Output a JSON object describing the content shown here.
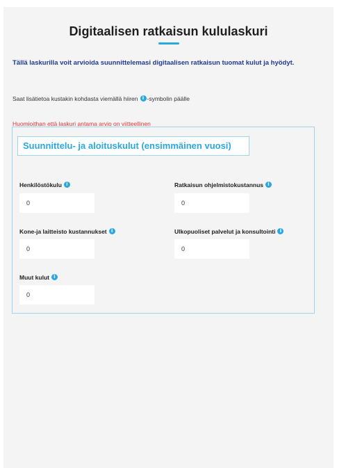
{
  "page": {
    "title": "Digitaalisen ratkaisun kululaskuri",
    "intro": "Tällä laskurilla voit arvioida suunnittelemasi digitaalisen ratkaisun tuomat kulut ja hyödyt.",
    "info_text_before": "Saat lisätietoa kustakin kohdasta viemällä hiiren",
    "info_text_after": "-symbolin päälle",
    "warning": "Huomioithan että laskuri antama arvio on viitteellinen"
  },
  "section": {
    "title": "Suunnittelu- ja aloituskulut (ensimmäinen vuosi)"
  },
  "fields": {
    "henkilostokulu": {
      "label": "Henkilöstökulu",
      "value": "0"
    },
    "ohjelmistokustannus": {
      "label": "Ratkaisun ohjelmistokustannus",
      "value": "0"
    },
    "laitteisto": {
      "label": "Kone-ja laitteisto kustannukset",
      "value": "0"
    },
    "ulkopuoliset": {
      "label": "Ulkopuoliset palvelut ja konsultointi",
      "value": "0"
    },
    "muut": {
      "label": "Muut kulut",
      "value": "0"
    }
  },
  "icons": {
    "info": "info-icon"
  },
  "colors": {
    "accent": "#29a8e0",
    "intro_text": "#1f3a93",
    "warning": "#e23636",
    "panel_border": "#9fd4ec",
    "page_background": "#f4f4f4"
  }
}
